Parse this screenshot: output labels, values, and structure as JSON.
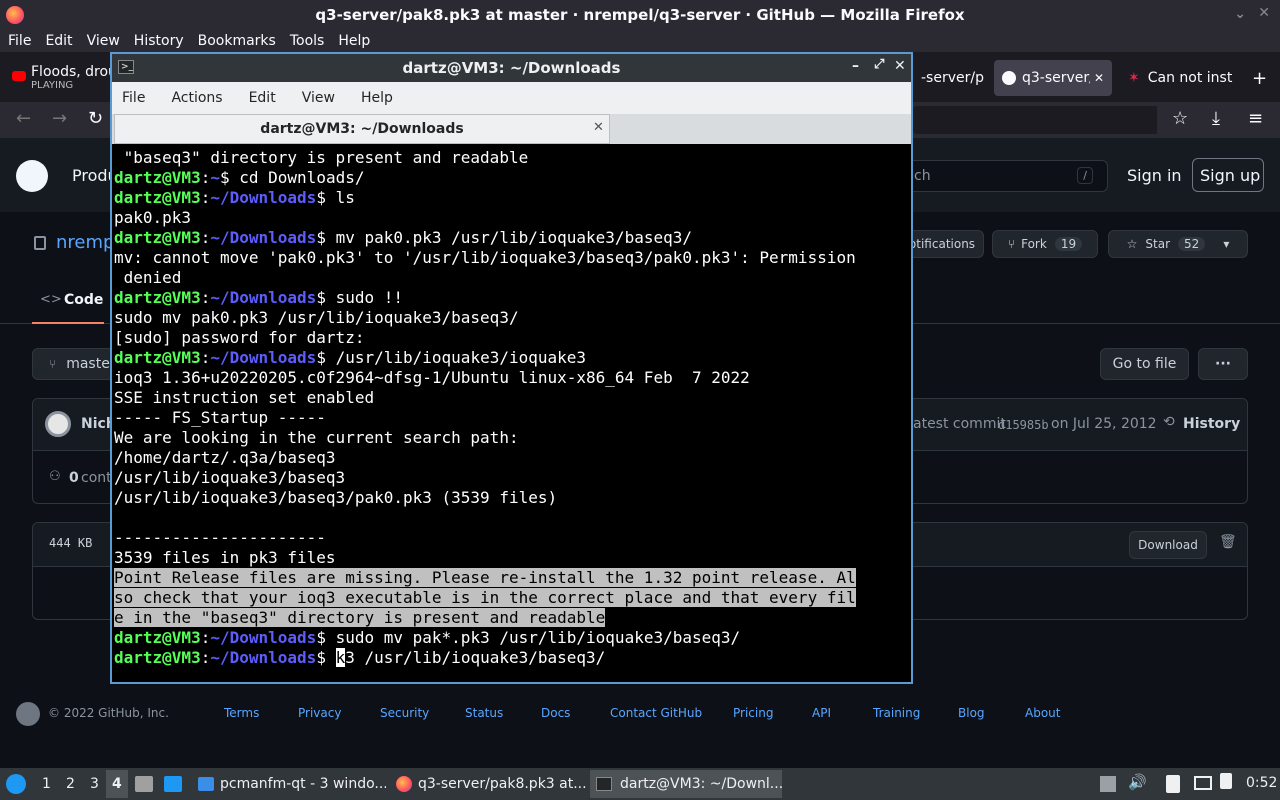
{
  "firefox": {
    "window_title": "q3-server/pak8.pk3 at master · nrempel/q3-server · GitHub — Mozilla Firefox",
    "menu": [
      "File",
      "Edit",
      "View",
      "History",
      "Bookmarks",
      "Tools",
      "Help"
    ],
    "tabs": [
      {
        "label": "Floods, drou",
        "sub": "PLAYING"
      },
      {
        "label": "-server/p"
      },
      {
        "label": "q3-server/"
      },
      {
        "label": "Can not inst"
      }
    ]
  },
  "github": {
    "nav_partial": "Produ",
    "search_placeholder": "ch",
    "search_key": "/",
    "sign_in": "Sign in",
    "sign_up": "Sign up",
    "repo_owner_partial": "nremp",
    "notifications_partial": "otifications",
    "fork_label": "Fork",
    "fork_count": "19",
    "star_label": "Star",
    "star_count": "52",
    "tab_code": "Code",
    "branch_partial": "maste",
    "go_to_file": "Go to file",
    "more": "···",
    "author_partial": "Nich",
    "latest_commit_prefix": "atest commit",
    "commit_hash": "d15985b",
    "commit_date": "on Jul 25, 2012",
    "history": "History",
    "contributors_count": "0",
    "contributors_partial": "contr",
    "file_size": "444 KB",
    "download": "Download",
    "footer": {
      "copyright": "© 2022 GitHub, Inc.",
      "links": [
        "Terms",
        "Privacy",
        "Security",
        "Status",
        "Docs",
        "Contact GitHub",
        "Pricing",
        "API",
        "Training",
        "Blog",
        "About"
      ]
    }
  },
  "terminal": {
    "title": "dartz@VM3: ~/Downloads",
    "menu": [
      "File",
      "Actions",
      "Edit",
      "View",
      "Help"
    ],
    "tab_title": "dartz@VM3: ~/Downloads",
    "prompt_user": "dartz@VM3",
    "prompt_sep": ":",
    "lines": [
      {
        "type": "out",
        "text": " \"baseq3\" directory is present and readable"
      },
      {
        "type": "cmd",
        "path": "~",
        "text": "$ cd Downloads/"
      },
      {
        "type": "cmd",
        "path": "~/Downloads",
        "text": "$ ls"
      },
      {
        "type": "out",
        "text": "pak0.pk3"
      },
      {
        "type": "cmd",
        "path": "~/Downloads",
        "text": "$ mv pak0.pk3 /usr/lib/ioquake3/baseq3/"
      },
      {
        "type": "out",
        "text": "mv: cannot move 'pak0.pk3' to '/usr/lib/ioquake3/baseq3/pak0.pk3': Permission"
      },
      {
        "type": "out",
        "text": " denied"
      },
      {
        "type": "cmd",
        "path": "~/Downloads",
        "text": "$ sudo !!"
      },
      {
        "type": "out",
        "text": "sudo mv pak0.pk3 /usr/lib/ioquake3/baseq3/"
      },
      {
        "type": "out",
        "text": "[sudo] password for dartz:"
      },
      {
        "type": "cmd",
        "path": "~/Downloads",
        "text": "$ /usr/lib/ioquake3/ioquake3"
      },
      {
        "type": "out",
        "text": "ioq3 1.36+u20220205.c0f2964~dfsg-1/Ubuntu linux-x86_64 Feb  7 2022"
      },
      {
        "type": "out",
        "text": "SSE instruction set enabled"
      },
      {
        "type": "out",
        "text": "----- FS_Startup -----"
      },
      {
        "type": "out",
        "text": "We are looking in the current search path:"
      },
      {
        "type": "out",
        "text": "/home/dartz/.q3a/baseq3"
      },
      {
        "type": "out",
        "text": "/usr/lib/ioquake3/baseq3"
      },
      {
        "type": "out",
        "text": "/usr/lib/ioquake3/baseq3/pak0.pk3 (3539 files)"
      },
      {
        "type": "out",
        "text": ""
      },
      {
        "type": "out",
        "text": "----------------------"
      },
      {
        "type": "out",
        "text": "3539 files in pk3 files"
      },
      {
        "type": "hl",
        "text": "Point Release files are missing. Please re-install the 1.32 point release. Al"
      },
      {
        "type": "hl",
        "text": "so check that your ioq3 executable is in the correct place and that every fil"
      },
      {
        "type": "hl",
        "text": "e in the \"baseq3\" directory is present and readable"
      },
      {
        "type": "cmd",
        "path": "~/Downloads",
        "text": "$ sudo mv pak*.pk3 /usr/lib/ioquake3/baseq3/"
      },
      {
        "type": "cur",
        "path": "~/Downloads",
        "text": "$ ",
        "cursor": "k",
        "after": "3 /usr/lib/ioquake3/baseq3/"
      }
    ]
  },
  "taskbar": {
    "workspaces": [
      "1",
      "2",
      "3",
      "4"
    ],
    "items": [
      "pcmanfm-qt - 3 windo...",
      "q3-server/pak8.pk3 at...",
      "dartz@VM3: ~/Downl..."
    ],
    "clock": "0:52"
  },
  "colors": {
    "prompt_user": "#55ff55",
    "prompt_path": "#5c5cff",
    "terminal_bg": "#000000",
    "github_bg": "#0d1117",
    "link": "#58a6ff"
  }
}
